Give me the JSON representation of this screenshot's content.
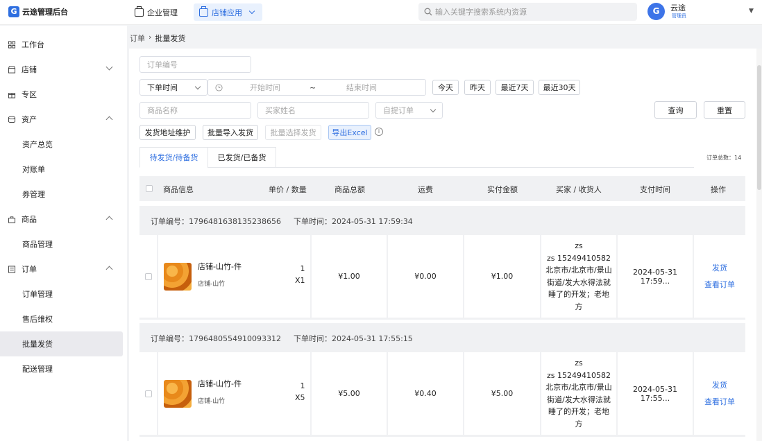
{
  "app": {
    "title": "云途管理后台",
    "logo_glyph": "G"
  },
  "top_nav": {
    "enterprise": "企业管理",
    "shop_apps": "店铺应用"
  },
  "search": {
    "placeholder": "输入关键字搜索系统内资源"
  },
  "user": {
    "avatar": "G",
    "name": "云途",
    "role": "管理员"
  },
  "sidebar": {
    "workbench": "工作台",
    "shop": "店铺",
    "zone": "专区",
    "assets": "资产",
    "assets_overview": "资产总览",
    "reconciliation": "对账单",
    "coupons": "券管理",
    "goods": "商品",
    "goods_manage": "商品管理",
    "orders": "订单",
    "order_manage": "订单管理",
    "after_sales": "售后维权",
    "batch_ship": "批量发货",
    "delivery": "配送管理"
  },
  "breadcrumb": {
    "parent": "订单",
    "sep": "›",
    "current": "批量发货"
  },
  "filters": {
    "order_no_placeholder": "订单编号",
    "time_type": "下单时间",
    "start_placeholder": "开始时间",
    "range_sep": "~",
    "end_placeholder": "结束时间",
    "today": "今天",
    "yesterday": "昨天",
    "last7": "最近7天",
    "last30": "最近30天",
    "goods_placeholder": "商品名称",
    "buyer_placeholder": "买家姓名",
    "pickup_type": "自提订单",
    "query": "查询",
    "reset": "重置"
  },
  "actions": {
    "ship_address": "发货地址维护",
    "batch_import": "批量导入发货",
    "batch_select": "批量选择发货",
    "export": "导出Excel",
    "info": "i"
  },
  "tabs": {
    "pending": "待发货/待备货",
    "shipped": "已发货/已备货"
  },
  "order_total": "订单总数：14",
  "table_headers": [
    "商品信息",
    "单价 / 数量",
    "商品总额",
    "运费",
    "实付金额",
    "买家 / 收货人",
    "支付时间",
    "操作"
  ],
  "orders": [
    {
      "order_no": "订单编号：1796481638135238656",
      "order_time": "下单时间：2024-05-31 17:59:34",
      "product_name": "店铺-山竹-件",
      "shop": "店铺-山竹",
      "unit_price": "1",
      "qty": "X1",
      "goods_total": "¥1.00",
      "freight": "¥0.00",
      "paid": "¥1.00",
      "buyer_line1": "zs",
      "buyer_line2": "zs 15249410582",
      "buyer_line3": "北京市/北京市/景山",
      "buyer_line4": "街道/发大水得法就",
      "buyer_line5": "睡了的开发；老地",
      "buyer_line6": "方",
      "pay_time": "2024-05-31 17:59...",
      "ship": "发货",
      "view": "查看订单"
    },
    {
      "order_no": "订单编号：1796480554910093312",
      "order_time": "下单时间：2024-05-31 17:55:15",
      "product_name": "店铺-山竹-件",
      "shop": "店铺-山竹",
      "unit_price": "1",
      "qty": "X5",
      "goods_total": "¥5.00",
      "freight": "¥0.40",
      "paid": "¥5.00",
      "buyer_line1": "zs",
      "buyer_line2": "zs 15249410582",
      "buyer_line3": "北京市/北京市/景山",
      "buyer_line4": "街道/发大水得法就",
      "buyer_line5": "睡了的开发；老地",
      "buyer_line6": "方",
      "pay_time": "2024-05-31 17:55...",
      "ship": "发货",
      "view": "查看订单"
    }
  ]
}
